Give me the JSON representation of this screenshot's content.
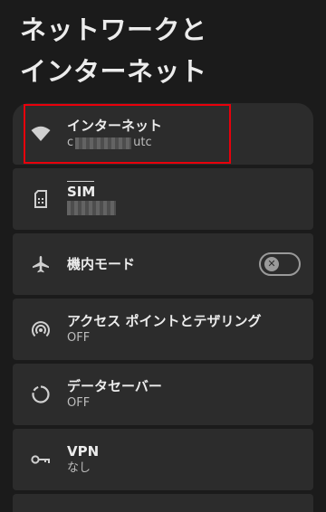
{
  "page": {
    "title_line1": "ネットワークと",
    "title_line2": "インターネット"
  },
  "items": [
    {
      "label": "インターネット",
      "sub_prefix": "c",
      "sub_suffix": "utc",
      "icon": "wifi-icon"
    },
    {
      "label": "SIM",
      "sub": "",
      "icon": "sim-card-icon"
    },
    {
      "label": "機内モード",
      "icon": "airplane-icon",
      "toggle_on": false
    },
    {
      "label": "アクセス ポイントとテザリング",
      "sub": "OFF",
      "icon": "hotspot-icon"
    },
    {
      "label": "データセーバー",
      "sub": "OFF",
      "icon": "data-saver-icon"
    },
    {
      "label": "VPN",
      "sub": "なし",
      "icon": "vpn-key-icon"
    }
  ],
  "colors": {
    "background": "#1b1b1b",
    "card": "#2c2c2c",
    "highlight": "#e8000b"
  }
}
